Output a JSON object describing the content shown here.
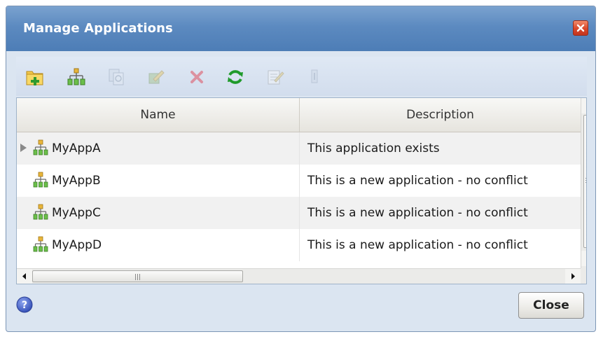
{
  "dialog": {
    "title": "Manage Applications",
    "close_icon": "close-icon"
  },
  "toolbar": {
    "buttons": [
      {
        "name": "add-folder",
        "icon": "folder-add-icon",
        "enabled": true
      },
      {
        "name": "new-application",
        "icon": "hierarchy-icon",
        "enabled": true
      },
      {
        "name": "copy",
        "icon": "copy-icon",
        "enabled": false
      },
      {
        "name": "edit-item",
        "icon": "pencil-icon",
        "enabled": false
      },
      {
        "name": "delete",
        "icon": "delete-icon",
        "enabled": false
      },
      {
        "name": "refresh",
        "icon": "refresh-icon",
        "enabled": true
      },
      {
        "name": "properties",
        "icon": "edit-note-icon",
        "enabled": false
      },
      {
        "name": "detach",
        "icon": "detach-icon",
        "enabled": false
      }
    ]
  },
  "grid": {
    "columns": {
      "name": "Name",
      "description": "Description"
    },
    "rows": [
      {
        "name": "MyAppA",
        "description": "This application exists",
        "expandable": true
      },
      {
        "name": "MyAppB",
        "description": "This is a new application - no conflict",
        "expandable": false
      },
      {
        "name": "MyAppC",
        "description": "This is a new application - no conflict",
        "expandable": false
      },
      {
        "name": "MyAppD",
        "description": "This is a new application - no conflict",
        "expandable": false
      }
    ]
  },
  "footer": {
    "help_icon": "help-icon",
    "close_label": "Close"
  },
  "colors": {
    "title_bar": "#5c8ac0",
    "dialog_bg": "#dbe5f1",
    "close_x": "#d9472a",
    "refresh_green": "#1f9a2a",
    "delete_red": "#e06070"
  }
}
